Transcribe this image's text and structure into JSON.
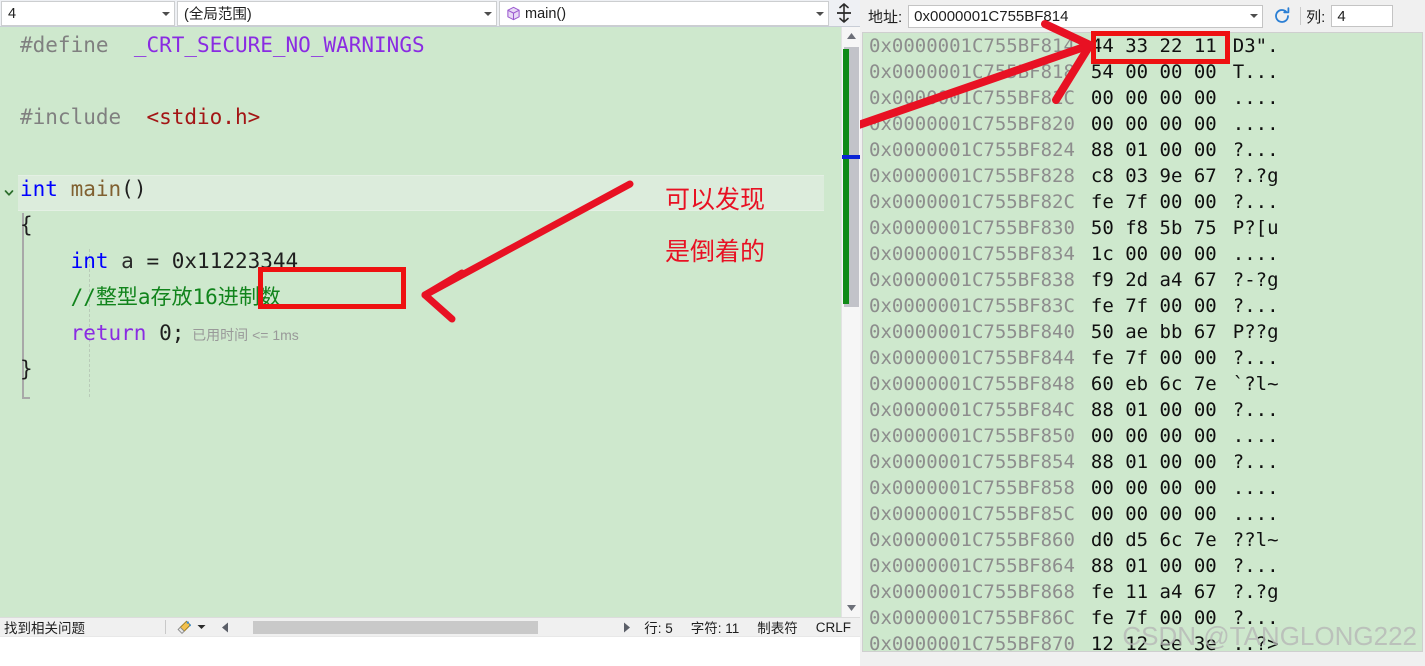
{
  "nav": {
    "scope_line": "4",
    "scope_global": "(全局范围)",
    "scope_function": "main()",
    "function_icon": "cube-icon",
    "split_icon": "split-window-icon"
  },
  "editor": {
    "lines": [
      {
        "indent": 0,
        "tokens": [
          {
            "t": "pp",
            "v": "#define"
          },
          {
            "t": "plain",
            "v": "  "
          },
          {
            "t": "macro",
            "v": "_CRT_SECURE_NO_WARNINGS"
          }
        ]
      },
      {
        "indent": 0,
        "tokens": []
      },
      {
        "indent": 0,
        "tokens": [
          {
            "t": "pp",
            "v": "#include"
          },
          {
            "t": "plain",
            "v": "  "
          },
          {
            "t": "str",
            "v": "<stdio.h>"
          }
        ]
      },
      {
        "indent": 0,
        "tokens": []
      },
      {
        "indent": 0,
        "tokens": [
          {
            "t": "kw",
            "v": "int"
          },
          {
            "t": "plain",
            "v": " "
          },
          {
            "t": "fn",
            "v": "main"
          },
          {
            "t": "plain",
            "v": "()"
          }
        ]
      },
      {
        "indent": 0,
        "tokens": [
          {
            "t": "plain",
            "v": "{"
          }
        ]
      },
      {
        "indent": 1,
        "tokens": [
          {
            "t": "kw",
            "v": "int"
          },
          {
            "t": "plain",
            "v": " "
          },
          {
            "t": "ident",
            "v": "a"
          },
          {
            "t": "plain",
            "v": " = "
          },
          {
            "t": "num",
            "v": "0x11223344"
          }
        ]
      },
      {
        "indent": 1,
        "tokens": [
          {
            "t": "cmt",
            "v": "//整型a存放16进制数"
          }
        ]
      },
      {
        "indent": 1,
        "tokens": [
          {
            "t": "kw2",
            "v": "return"
          },
          {
            "t": "plain",
            "v": " "
          },
          {
            "t": "num",
            "v": "0"
          },
          {
            "t": "plain",
            "v": ";"
          }
        ]
      },
      {
        "indent": 0,
        "tokens": [
          {
            "t": "plain",
            "v": "}"
          }
        ]
      }
    ],
    "elapsed_label": "已用时间 <= 1ms",
    "fold_chevron_icon": "chevron-down-icon"
  },
  "annotations": {
    "note_line1": "可以发现",
    "note_line2": "是倒着的",
    "highlight_color": "#ee1111",
    "arrow_icon": "red-arrow-icon"
  },
  "status": {
    "message": "找到相关问题",
    "brush_icon": "brush-icon",
    "brush_dropdown_icon": "chevron-down-icon",
    "scroll_left_icon": "triangle-left-icon",
    "scroll_right_icon": "triangle-right-icon",
    "line_label": "行: 5",
    "char_label": "字符: 11",
    "tab_label": "制表符",
    "eol_label": "CRLF"
  },
  "memory": {
    "address_label": "地址:",
    "address_value": "0x0000001C755BF814",
    "refresh_icon": "refresh-icon",
    "columns_label": "列:",
    "columns_value": "4",
    "rows": [
      {
        "addr": "0x0000001C755BF814",
        "hex": "44 33 22 11",
        "ascii": "D3\"."
      },
      {
        "addr": "0x0000001C755BF818",
        "hex": "54 00 00 00",
        "ascii": "T..."
      },
      {
        "addr": "0x0000001C755BF81C",
        "hex": "00 00 00 00",
        "ascii": "...."
      },
      {
        "addr": "0x0000001C755BF820",
        "hex": "00 00 00 00",
        "ascii": "...."
      },
      {
        "addr": "0x0000001C755BF824",
        "hex": "88 01 00 00",
        "ascii": "?..."
      },
      {
        "addr": "0x0000001C755BF828",
        "hex": "c8 03 9e 67",
        "ascii": "?.?g"
      },
      {
        "addr": "0x0000001C755BF82C",
        "hex": "fe 7f 00 00",
        "ascii": "?..."
      },
      {
        "addr": "0x0000001C755BF830",
        "hex": "50 f8 5b 75",
        "ascii": "P?[u"
      },
      {
        "addr": "0x0000001C755BF834",
        "hex": "1c 00 00 00",
        "ascii": "...."
      },
      {
        "addr": "0x0000001C755BF838",
        "hex": "f9 2d a4 67",
        "ascii": "?-?g"
      },
      {
        "addr": "0x0000001C755BF83C",
        "hex": "fe 7f 00 00",
        "ascii": "?..."
      },
      {
        "addr": "0x0000001C755BF840",
        "hex": "50 ae bb 67",
        "ascii": "P??g"
      },
      {
        "addr": "0x0000001C755BF844",
        "hex": "fe 7f 00 00",
        "ascii": "?..."
      },
      {
        "addr": "0x0000001C755BF848",
        "hex": "60 eb 6c 7e",
        "ascii": "`?l~"
      },
      {
        "addr": "0x0000001C755BF84C",
        "hex": "88 01 00 00",
        "ascii": "?..."
      },
      {
        "addr": "0x0000001C755BF850",
        "hex": "00 00 00 00",
        "ascii": "...."
      },
      {
        "addr": "0x0000001C755BF854",
        "hex": "88 01 00 00",
        "ascii": "?..."
      },
      {
        "addr": "0x0000001C755BF858",
        "hex": "00 00 00 00",
        "ascii": "...."
      },
      {
        "addr": "0x0000001C755BF85C",
        "hex": "00 00 00 00",
        "ascii": "...."
      },
      {
        "addr": "0x0000001C755BF860",
        "hex": "d0 d5 6c 7e",
        "ascii": "??l~"
      },
      {
        "addr": "0x0000001C755BF864",
        "hex": "88 01 00 00",
        "ascii": "?..."
      },
      {
        "addr": "0x0000001C755BF868",
        "hex": "fe 11 a4 67",
        "ascii": "?.?g"
      },
      {
        "addr": "0x0000001C755BF86C",
        "hex": "fe 7f 00 00",
        "ascii": "?..."
      },
      {
        "addr": "0x0000001C755BF870",
        "hex": "12 12 ee 3e",
        "ascii": "..?>"
      }
    ]
  },
  "watermark": "CSDN @TANGLONG222"
}
